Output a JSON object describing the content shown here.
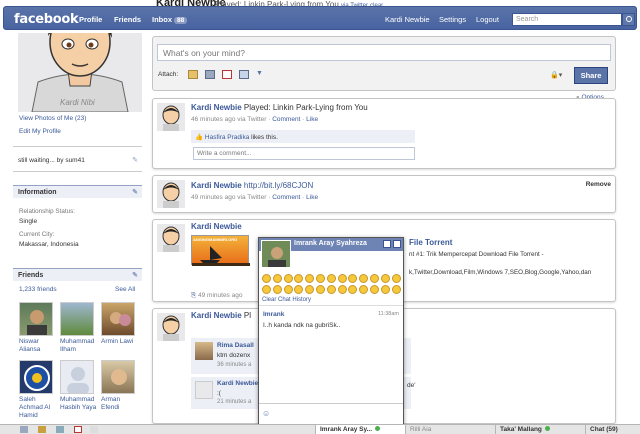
{
  "header": {
    "logo": "facebook",
    "nav": [
      "Profile",
      "Friends",
      "Inbox"
    ],
    "inbox_count": "88",
    "right_nav": [
      "Kardi Newbie",
      "Settings",
      "Logout"
    ],
    "search_placeholder": "Search",
    "ghost_name": "Kardi Newbie",
    "ghost_status": "Played: Linkin Park-Lying from You",
    "ghost_via": "via Twitter",
    "ghost_clear": "clear"
  },
  "profile": {
    "photo_caption": "Kardi Nibi",
    "view_photos": "View Photos of Me (23)",
    "edit_profile": "Edit My Profile",
    "status": "still waiting... by sum41"
  },
  "info": {
    "title": "Information",
    "rel_label": "Relationship Status:",
    "rel_value": "Single",
    "city_label": "Current City:",
    "city_value": "Makassar, Indonesia"
  },
  "friends": {
    "title": "Friends",
    "count": "1,233 friends",
    "see_all": "See All",
    "list": [
      {
        "name": "Niswar Aliansa"
      },
      {
        "name": "Muhammad Ilham"
      },
      {
        "name": "Armin Lawi"
      },
      {
        "name": "Saleh Achmad Al Hamid"
      },
      {
        "name": "Muhammad Hasbih Yaya"
      },
      {
        "name": "Arman Efendi"
      }
    ]
  },
  "composer": {
    "placeholder": "What's on your mind?",
    "attach": "Attach:",
    "share": "Share",
    "options": "Options"
  },
  "stories": [
    {
      "name": "Kardi Newbie",
      "text": "Played: Linkin Park-Lying from You",
      "meta": "46 minutes ago via Twitter",
      "comment": "Comment",
      "like": "Like",
      "likes_name": "Hasfira Pradika",
      "likes_text": "likes this.",
      "write_comment": "Write a comment..."
    },
    {
      "name": "Kardi Newbie",
      "text": "http://bit.ly/68CJON",
      "meta": "49 minutes ago via Twitter",
      "comment": "Comment",
      "like": "Like",
      "remove": "Remove"
    },
    {
      "name": "Kardi Newbie",
      "link_title": "File Torrent",
      "link_desc": "nt #1: Trik Mempercepat Download File Torrent -",
      "link_desc2": "k,Twitter,Download,Film,Windows 7,SEO,Blog,Google,Yahoo,dan",
      "meta": "49 minutes ago",
      "blog_banner": "ANGINGMAMMIRI.ORG"
    },
    {
      "name": "Kardi Newbie",
      "text": "Pl",
      "c1_name": "Rima Dasall",
      "c1_text": "ktm dozenx",
      "c1_meta": "36 minutes a",
      "c2_name": "Kardi Newbie",
      "c2_text": ":(",
      "c2_meta": "21 minutes a",
      "c2_tail": "de'"
    }
  ],
  "chat": {
    "name": "Imrank Aray Syahreza",
    "clear_history": "Clear Chat History",
    "msg_from": "Imrank",
    "msg_time": "11:38am",
    "msg_text": "I..h kanda ndk na gubriSk.."
  },
  "bottom": {
    "tab1": "Imrank Aray Sy...",
    "tab2": "Rilli Aia",
    "tab3": "Taka' Mallang",
    "chat": "Chat (59)"
  }
}
